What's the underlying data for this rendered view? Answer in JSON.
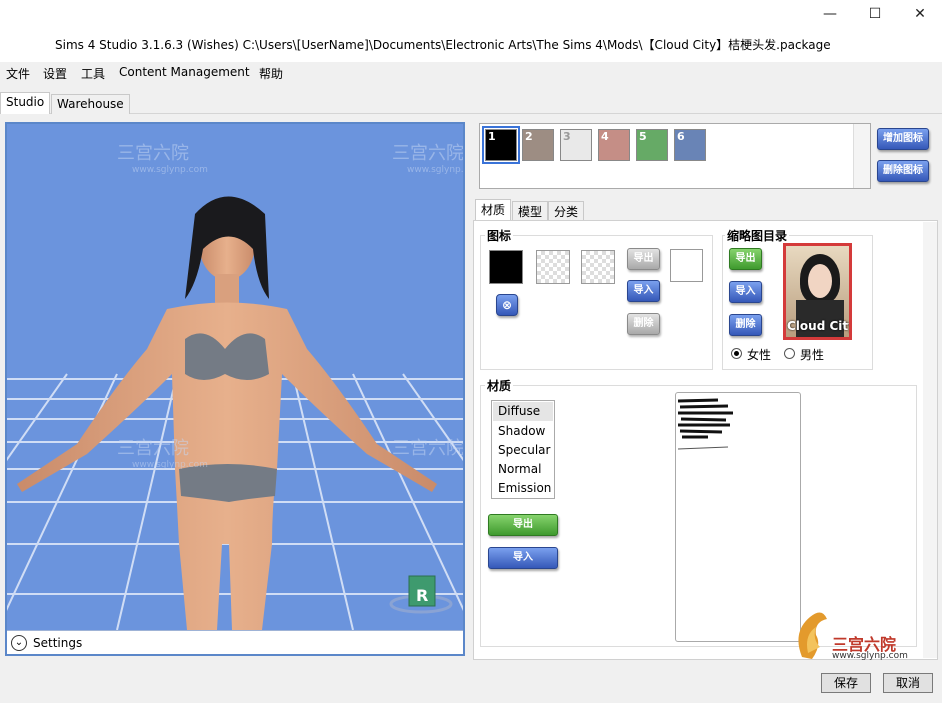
{
  "window": {
    "title": "Sims 4 Studio 3.1.6.3 (Wishes)  C:\\Users\\[UserName]\\Documents\\Electronic Arts\\The Sims 4\\Mods\\【Cloud City】桔梗头发.package",
    "minimize": "—",
    "maximize": "☐",
    "close": "✕"
  },
  "menu": [
    "文件",
    "设置",
    "工具",
    "Content Management",
    "帮助"
  ],
  "main_tabs": [
    "Studio",
    "Warehouse"
  ],
  "viewport": {
    "settings_label": "Settings",
    "watermark": "三宫六院",
    "watermark_url": "www.sglynp.com",
    "reset_label": "R"
  },
  "swatches": [
    {
      "num": "1",
      "color": "#000000"
    },
    {
      "num": "2",
      "color": "#9d8d83"
    },
    {
      "num": "3",
      "color": "#e9e9e9"
    },
    {
      "num": "4",
      "color": "#c58e86"
    },
    {
      "num": "5",
      "color": "#66aa66"
    },
    {
      "num": "6",
      "color": "#6984b6"
    }
  ],
  "swatch_buttons": {
    "add": "增加图标",
    "delete": "删除图标"
  },
  "sub_tabs": [
    "材质",
    "模型",
    "分类"
  ],
  "icon_group": {
    "title": "图标",
    "export": "导出",
    "import": "导入",
    "delete": "删除"
  },
  "thumb_group": {
    "title": "缩略图目录",
    "export": "导出",
    "import": "导入",
    "delete": "删除",
    "thumb_caption": "Cloud City",
    "female": "女性",
    "male": "男性"
  },
  "material_group": {
    "title": "材质",
    "items": [
      "Diffuse",
      "Shadow",
      "Specular",
      "Normal",
      "Emission"
    ],
    "export": "导出",
    "import": "导入"
  },
  "logo": {
    "name": "三宫六院",
    "url": "www.sglynp.com"
  },
  "footer": {
    "save": "保存",
    "cancel": "取消"
  }
}
